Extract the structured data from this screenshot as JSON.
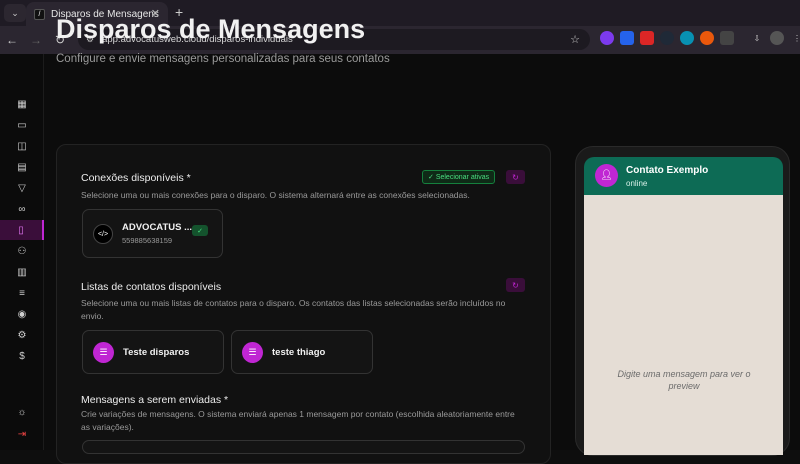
{
  "browser": {
    "tab_title": "Disparos de Mensagens",
    "tab_close": "✕",
    "new_tab": "+",
    "url": "app.advocatusweb.cloud/disparos-individuais"
  },
  "page": {
    "title": "Disparos de Mensagens",
    "subtitle": "Configure e envie mensagens personalizadas para seus contatos"
  },
  "connections": {
    "title": "Conexões disponíveis *",
    "description": "Selecione uma ou mais conexões para o disparo. O sistema alternará entre as conexões selecionadas.",
    "select_active_label": "Selecionar ativas",
    "items": [
      {
        "name": "ADVOCATUS ...",
        "number": "559885638159"
      }
    ]
  },
  "contact_lists": {
    "title": "Listas de contatos disponíveis",
    "description": "Selecione uma ou mais listas de contatos para o disparo. Os contatos das listas selecionadas serão incluídos no envio.",
    "items": [
      {
        "label": "Teste disparos"
      },
      {
        "label": "teste thiago"
      }
    ]
  },
  "messages": {
    "title": "Mensagens a serem enviadas *",
    "description": "Crie variações de mensagens. O sistema enviará apenas 1 mensagem por contato (escolhida aleatoriamente entre as variações)."
  },
  "preview": {
    "contact_name": "Contato Exemplo",
    "status": "online",
    "placeholder": "Digite uma mensagem para ver o preview"
  },
  "colors": {
    "accent": "#c026d3",
    "whatsapp_header": "#0d6b55",
    "success": "#4ade80"
  }
}
